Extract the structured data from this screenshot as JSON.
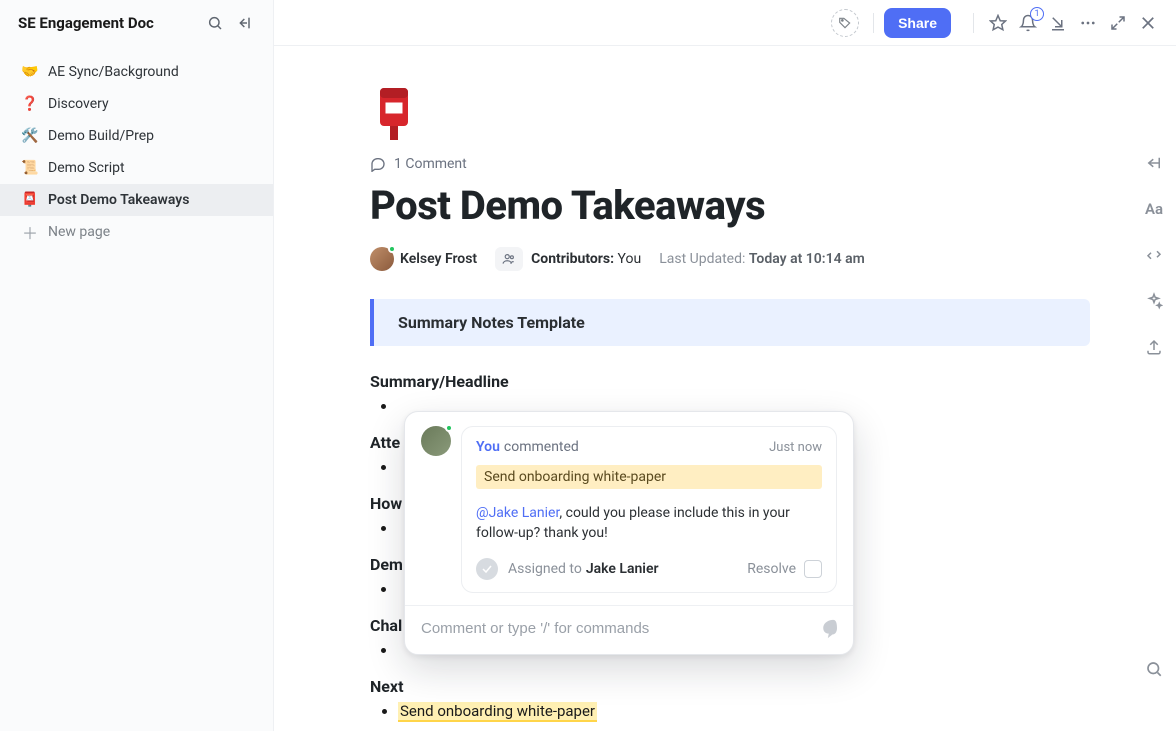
{
  "sidebar": {
    "title": "SE Engagement Doc",
    "items": [
      {
        "emoji": "🤝",
        "label": "AE Sync/Background"
      },
      {
        "emoji": "❓",
        "label": "Discovery"
      },
      {
        "emoji": "🛠️",
        "label": "Demo Build/Prep"
      },
      {
        "emoji": "📜",
        "label": "Demo Script"
      },
      {
        "emoji": "📮",
        "label": "Post Demo Takeaways"
      }
    ],
    "new_page_label": "New page"
  },
  "topbar": {
    "share_label": "Share",
    "notification_count": "1"
  },
  "doc": {
    "comment_count": "1 Comment",
    "title": "Post Demo Takeaways",
    "author": "Kelsey Frost",
    "contributors_label": "Contributors:",
    "contributors_value": "You",
    "updated_label": "Last Updated:",
    "updated_value": "Today at 10:14 am",
    "callout": "Summary Notes Template",
    "sections": [
      "Summary/Headline",
      "Atte",
      "How",
      "Dem",
      "Chal",
      "Next"
    ],
    "next_item": "Send onboarding white-paper"
  },
  "popover": {
    "you_label": "You",
    "action_label": "commented",
    "time_label": "Just now",
    "quoted": "Send onboarding white-paper",
    "mention": "@Jake Lanier",
    "message_tail": ", could you please include this in your follow-up? thank you!",
    "assigned_label": "Assigned to",
    "assignee": "Jake Lanier",
    "resolve_label": "Resolve",
    "input_placeholder": "Comment or type '/' for commands"
  }
}
